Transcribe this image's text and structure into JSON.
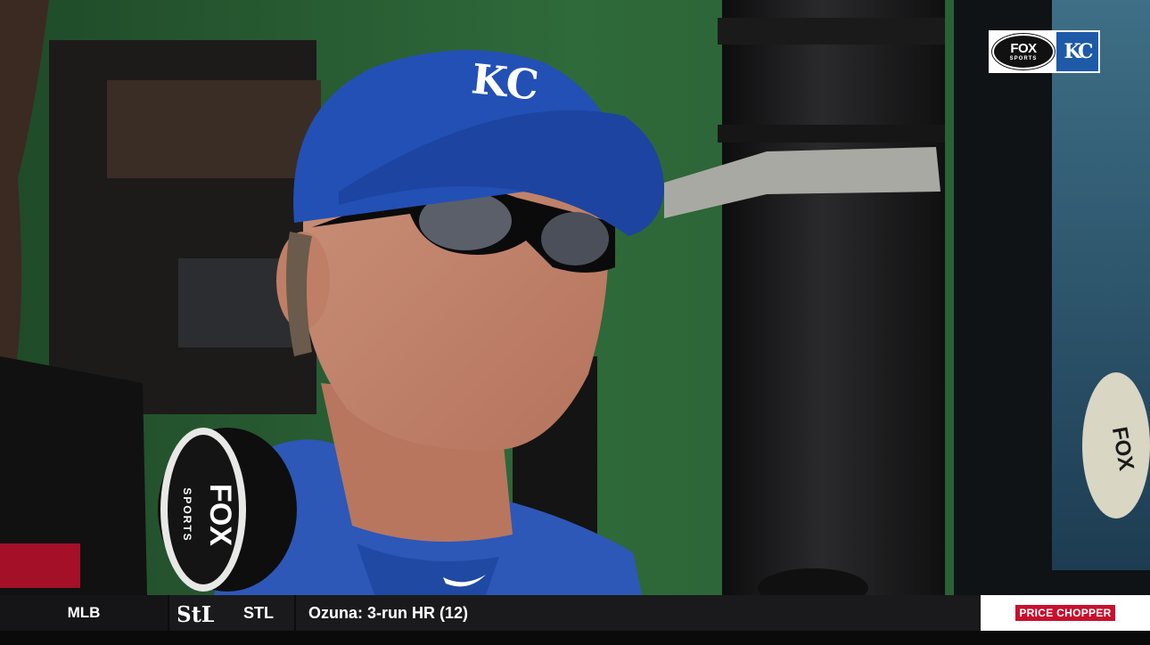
{
  "bug": {
    "network": "FOX",
    "network_sub": "SPORTS",
    "team_logo": "KC"
  },
  "scene": {
    "cap_logo": "KC",
    "mic_word_1": "FOX",
    "mic_word_2": "SPORTS",
    "reflection_word": "FOX"
  },
  "ticker": {
    "league": "MLB",
    "team_logo_text": "StL",
    "team": "STL",
    "headline": "Ozuna: 3-run HR (12)",
    "sponsor": "PRICE CHOPPER"
  },
  "colors": {
    "dugout_green": "#2f6a3a",
    "royals_blue": "#1e5aa8",
    "cardinals_red": "#c8102e",
    "ticker_bg": "#1a1a1c"
  }
}
